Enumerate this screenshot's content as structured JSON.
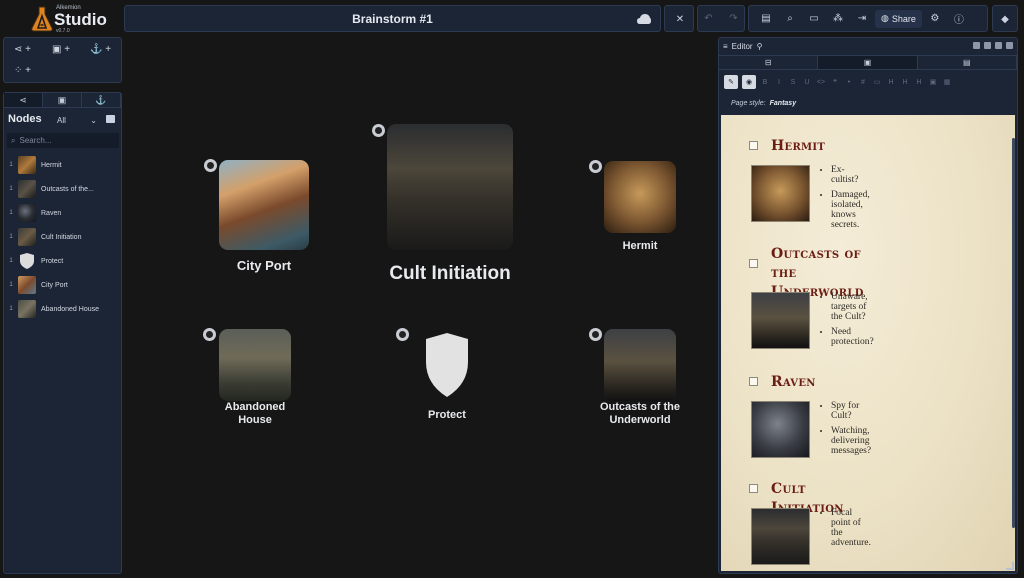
{
  "logo": {
    "sub": "Alkemion",
    "main": "Studio",
    "version": "v0.7.0"
  },
  "header": {
    "title": "Brainstorm #1",
    "share_label": "Share"
  },
  "left_panel": {
    "nodes_title": "Nodes",
    "filter_value": "All",
    "search_placeholder": "Search...",
    "nodes": [
      {
        "count": "1",
        "name": "Hermit"
      },
      {
        "count": "1",
        "name": "Outcasts of the..."
      },
      {
        "count": "1",
        "name": "Raven"
      },
      {
        "count": "1",
        "name": "Cult Initiation"
      },
      {
        "count": "1",
        "name": "Protect"
      },
      {
        "count": "1",
        "name": "City Port"
      },
      {
        "count": "1",
        "name": "Abandoned House"
      }
    ]
  },
  "canvas": {
    "nodes": {
      "city_port": "City Port",
      "cult_initiation": "Cult Initiation",
      "hermit": "Hermit",
      "abandoned_house_l1": "Abandoned",
      "abandoned_house_l2": "House",
      "protect": "Protect",
      "outcasts_l1": "Outcasts of the",
      "outcasts_l2": "Underworld"
    }
  },
  "editor": {
    "title": "Editor",
    "page_style_label": "Page style:",
    "page_style_value": "Fantasy",
    "entries": [
      {
        "heading": "Hermit",
        "bullets": [
          "Ex-cultist?",
          "Damaged, isolated, knows secrets."
        ]
      },
      {
        "heading_l1": "Outcasts of the",
        "heading_l2": "Underworld",
        "bullets": [
          "Unaware, targets of the Cult?",
          "Need protection?"
        ]
      },
      {
        "heading": "Raven",
        "bullets": [
          "Spy for Cult?",
          "Watching, delivering messages?"
        ]
      },
      {
        "heading": "Cult Initiation",
        "bullets": [
          "Focal point of the adventure."
        ]
      }
    ]
  },
  "colors": {
    "panel": "#1c2536",
    "accent_heading": "#6b1d14",
    "parchment": "#efe6cc"
  }
}
